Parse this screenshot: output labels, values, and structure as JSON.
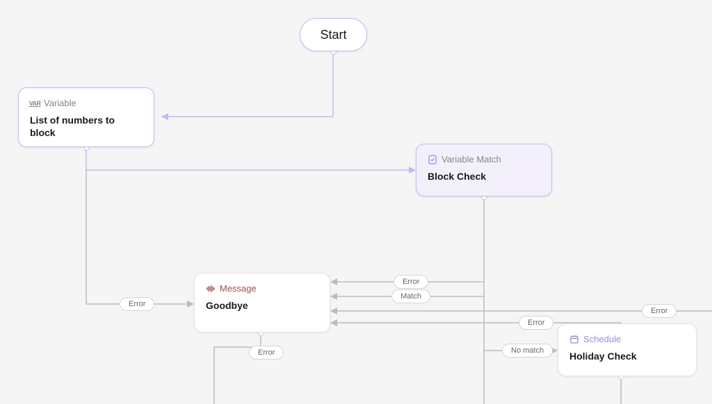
{
  "nodes": {
    "start": {
      "label": "Start"
    },
    "variable": {
      "type": "Variable",
      "title": "List of numbers to block"
    },
    "blockcheck": {
      "type": "Variable Match",
      "title": "Block Check"
    },
    "goodbye": {
      "type": "Message",
      "title": "Goodbye"
    },
    "holiday": {
      "type": "Schedule",
      "title": "Holiday Check"
    }
  },
  "labels": {
    "error": "Error",
    "match": "Match",
    "nomatch": "No match"
  },
  "colors": {
    "purple": "#c5b8f0",
    "purpleLight": "#f3f0fc",
    "gray": "#bbb",
    "red": "#a84b4b"
  }
}
